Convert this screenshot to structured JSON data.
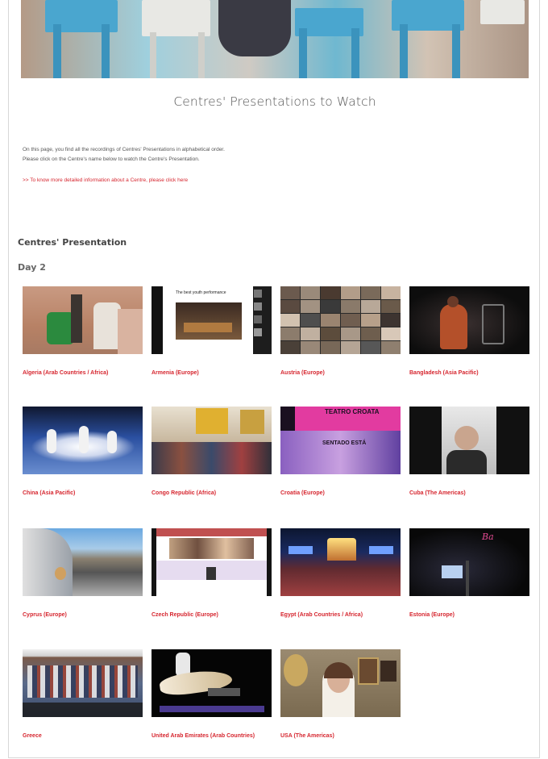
{
  "page": {
    "title": "Centres' Presentations to Watch",
    "intro_line1": "On this page, you find all the recordings of Centres' Presentations in alphabetical order.",
    "intro_line2": "Please click on the Centre's name below to watch the Centre's Presentation.",
    "more_info_link": ">> To know more detailed information about a Centre, please click here",
    "section_title": "Centres' Presentation",
    "day_title": "Day 2"
  },
  "centres": [
    {
      "label": "Algeria (Arab Countries / Africa)"
    },
    {
      "label": "Armenia (Europe)"
    },
    {
      "label": "Austria (Europe)"
    },
    {
      "label": "Bangladesh (Asia Pacific)"
    },
    {
      "label": "China (Asia Pacific)"
    },
    {
      "label": "Congo Republic (Africa)"
    },
    {
      "label": "Croatia (Europe)"
    },
    {
      "label": "Cuba (The Americas)"
    },
    {
      "label": "Cyprus (Europe)"
    },
    {
      "label": "Czech Republic (Europe)"
    },
    {
      "label": "Egypt (Arab Countries / Africa)"
    },
    {
      "label": "Estonia (Europe)"
    },
    {
      "label": "Greece"
    },
    {
      "label": "United Arab Emirates (Arab Countries)"
    },
    {
      "label": "USA (The Americas)"
    }
  ],
  "thumb_text": {
    "armenia_caption": "The best youth performance",
    "croatia_top": "TEATRO CROATA",
    "croatia_mid": "SENTADO ESTÁ"
  }
}
